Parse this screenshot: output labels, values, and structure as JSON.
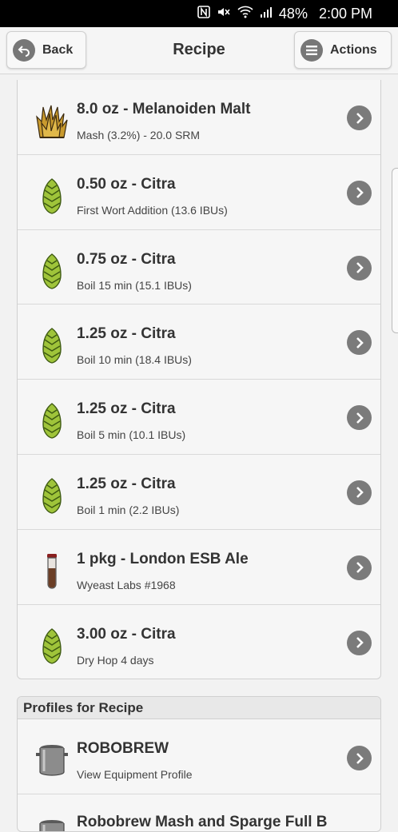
{
  "status_bar": {
    "battery": "48%",
    "time": "2:00 PM",
    "icons": [
      "nfc-icon",
      "mute-icon",
      "wifi-icon",
      "signal-icon"
    ]
  },
  "header": {
    "back_label": "Back",
    "title": "Recipe",
    "actions_label": "Actions"
  },
  "ingredients": [
    {
      "title": "8.0 oz - Melanoiden Malt",
      "subtitle": "Mash (3.2%) - 20.0 SRM",
      "icon": "grain-icon"
    },
    {
      "title": "0.50 oz - Citra",
      "subtitle": "First Wort Addition (13.6 IBUs)",
      "icon": "hop-icon"
    },
    {
      "title": "0.75 oz - Citra",
      "subtitle": "Boil 15 min (15.1 IBUs)",
      "icon": "hop-icon"
    },
    {
      "title": "1.25 oz - Citra",
      "subtitle": "Boil 10 min (18.4 IBUs)",
      "icon": "hop-icon"
    },
    {
      "title": "1.25 oz - Citra",
      "subtitle": "Boil 5 min (10.1 IBUs)",
      "icon": "hop-icon"
    },
    {
      "title": "1.25 oz - Citra",
      "subtitle": "Boil 1 min (2.2 IBUs)",
      "icon": "hop-icon"
    },
    {
      "title": "1 pkg - London ESB Ale",
      "subtitle": "Wyeast Labs #1968",
      "icon": "yeast-vial-icon"
    },
    {
      "title": "3.00 oz - Citra",
      "subtitle": "Dry Hop 4 days",
      "icon": "hop-icon"
    }
  ],
  "profiles": {
    "heading": "Profiles for Recipe",
    "items": [
      {
        "title": "ROBOBREW",
        "subtitle": "View Equipment Profile",
        "icon": "kettle-icon"
      },
      {
        "title": "Robobrew Mash and Sparge Full B",
        "subtitle": "",
        "icon": "kettle-icon"
      }
    ]
  }
}
